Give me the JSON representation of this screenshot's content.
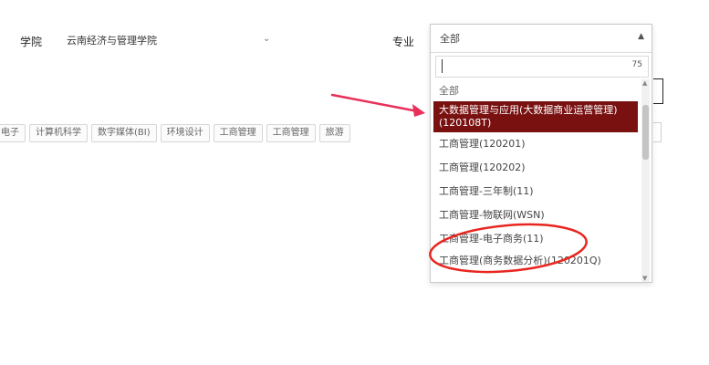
{
  "filters": {
    "college_label": "学院",
    "college_value": "云南经济与管理学院",
    "major_label": "专业"
  },
  "tabs": [
    "电子",
    "计算机科学",
    "数字媒体(BI)",
    "环境设计",
    "工商管理",
    "工商管理",
    "旅游"
  ],
  "dropdown": {
    "selected_value": "全部",
    "search_count": "75",
    "options": [
      {
        "label": "全部",
        "state": "header"
      },
      {
        "label": "大数据管理与应用(大数据商业运营管理)(120108T)",
        "state": "selected"
      },
      {
        "label": "工商管理(120201)",
        "state": "normal"
      },
      {
        "label": "工商管理(120202)",
        "state": "normal"
      },
      {
        "label": "工商管理-三年制(11)",
        "state": "normal"
      },
      {
        "label": "工商管理-物联网(WSN)",
        "state": "normal"
      },
      {
        "label": "工商管理-电子商务(11)",
        "state": "normal"
      },
      {
        "label": "工商管理(商务数据分析)(120201Q)",
        "state": "wrap"
      }
    ]
  },
  "annotations": {
    "arrow_color": "#e8305a",
    "circle_color": "#e8261f",
    "selected_color": "#7a1111"
  }
}
